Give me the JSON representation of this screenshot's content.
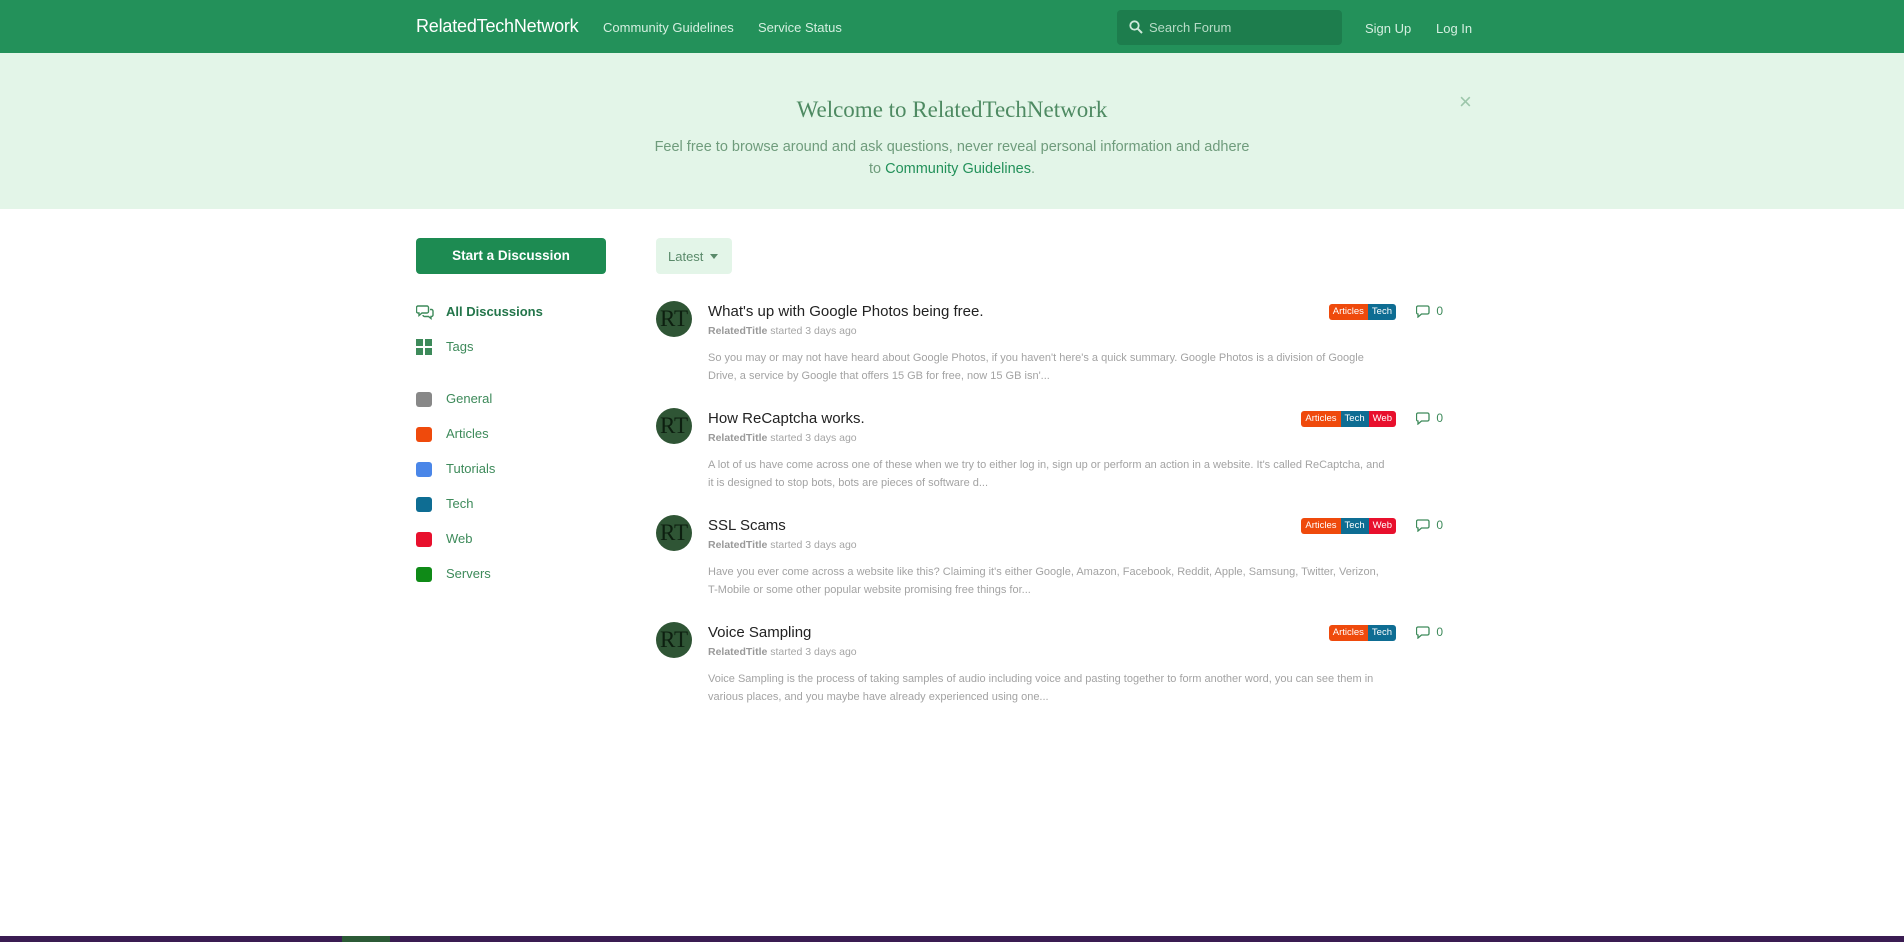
{
  "header": {
    "brand": "RelatedTechNetwork",
    "nav": [
      "Community Guidelines",
      "Service Status"
    ],
    "search_placeholder": "Search Forum",
    "signup_label": "Sign Up",
    "login_label": "Log In",
    "search_icon": "search-icon"
  },
  "hero": {
    "title": "Welcome to RelatedTechNetwork",
    "text": "Feel free to browse around and ask questions, never reveal personal information and adhere to",
    "link": "Community Guidelines",
    "text_end": ".",
    "close": "×"
  },
  "sidebar": {
    "start_button": "Start a Discussion",
    "nav": [
      {
        "label": "All Discussions",
        "icon": "chat-bubbles-icon",
        "active": true
      },
      {
        "label": "Tags",
        "icon": "grid-icon",
        "active": false
      }
    ],
    "tags": [
      {
        "label": "General",
        "color": "#888888"
      },
      {
        "label": "Articles",
        "color": "#ef4a0c"
      },
      {
        "label": "Tutorials",
        "color": "#4a86e8"
      },
      {
        "label": "Tech",
        "color": "#0e6d93"
      },
      {
        "label": "Web",
        "color": "#e8102d"
      },
      {
        "label": "Servers",
        "color": "#0f8a17"
      }
    ]
  },
  "sort": {
    "selected": "Latest"
  },
  "discussions": [
    {
      "avatar": "RT",
      "title": "What's up with Google Photos being free.",
      "author": "RelatedTitle",
      "meta": "started 3 days ago",
      "excerpt": "So you may or may not have heard about Google Photos, if you haven't here's a quick summary. Google Photos is a division of Google Drive, a service by Google that offers 15 GB for free, now 15 GB isn'...",
      "tags": [
        "Articles",
        "Tech"
      ],
      "replies": "0"
    },
    {
      "avatar": "RT",
      "title": "How ReCaptcha works.",
      "author": "RelatedTitle",
      "meta": "started 3 days ago",
      "excerpt": "A lot of us have come across one of these when we try to either log in, sign up or perform an action in a website. It's called ReCaptcha, and it is designed to stop bots, bots are pieces of software d...",
      "tags": [
        "Articles",
        "Tech",
        "Web"
      ],
      "replies": "0"
    },
    {
      "avatar": "RT",
      "title": "SSL Scams",
      "author": "RelatedTitle",
      "meta": "started 3 days ago",
      "excerpt": "Have you ever come across a website like this? Claiming it's either Google, Amazon, Facebook, Reddit, Apple, Samsung, Twitter, Verizon, T-Mobile or some other popular website promising free things for...",
      "tags": [
        "Articles",
        "Tech",
        "Web"
      ],
      "replies": "0"
    },
    {
      "avatar": "RT",
      "title": "Voice Sampling",
      "author": "RelatedTitle",
      "meta": "started 3 days ago",
      "excerpt": "Voice Sampling is the process of taking samples of audio including voice and pasting together to form another word, you can see them in various places, and you maybe have already experienced using one...",
      "tags": [
        "Articles",
        "Tech"
      ],
      "replies": "0"
    }
  ],
  "colors": {
    "header": "#23915a",
    "hero_bg": "#e3f5e8",
    "accent": "#1d8b52"
  }
}
